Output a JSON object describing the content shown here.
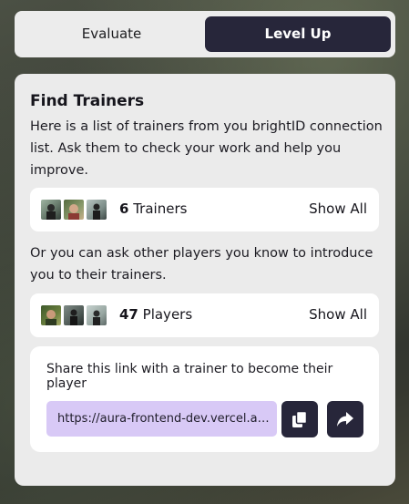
{
  "tabs": [
    {
      "label": "Evaluate",
      "active": false
    },
    {
      "label": "Level Up",
      "active": true
    }
  ],
  "find_trainers": {
    "title": "Find Trainers",
    "description": "Here is a list of trainers from you brightID connection list. Ask them to check your work and help you improve.",
    "trainers_row": {
      "count": "6",
      "label": "Trainers",
      "show_all_label": "Show All",
      "avatars": [
        "trainer-avatar-1",
        "trainer-avatar-2",
        "trainer-avatar-3"
      ]
    },
    "alt_description": "Or you can ask other players you know to introduce you to their trainers.",
    "players_row": {
      "count": "47",
      "label": "Players",
      "show_all_label": "Show All",
      "avatars": [
        "player-avatar-1",
        "player-avatar-2",
        "player-avatar-3"
      ]
    },
    "share": {
      "text": "Share this link with a trainer to become their player",
      "link": "https://aura-frontend-dev.vercel.app",
      "copy_icon": "copy-icon",
      "share_icon": "share-arrow-icon"
    }
  },
  "colors": {
    "dark": "#27263a",
    "card": "#ebebeb",
    "link_bg": "#d8c9f6",
    "white": "#ffffff"
  }
}
